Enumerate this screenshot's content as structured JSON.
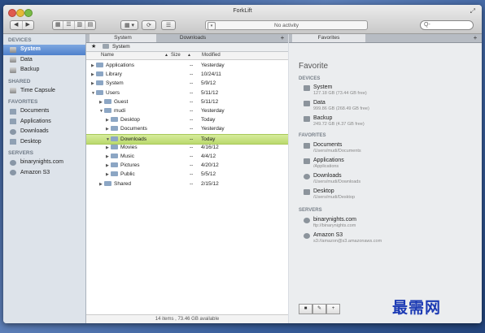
{
  "window": {
    "title": "ForkLift",
    "activity": "No activity",
    "search_placeholder": "Q-"
  },
  "toolbar": {
    "back": "◀",
    "forward": "▶",
    "view_modes": [
      "▦",
      "☰",
      "▥",
      "▤"
    ],
    "action": "▦ ▾",
    "sync": "⟳",
    "info": "☰"
  },
  "sidebar": {
    "devices_header": "DEVICES",
    "devices": [
      "System",
      "Data",
      "Backup"
    ],
    "shared_header": "SHARED",
    "shared": [
      "Time Capsule"
    ],
    "favorites_header": "FAVORITES",
    "favorites": [
      "Documents",
      "Applications",
      "Downloads",
      "Desktop"
    ],
    "servers_header": "SERVERS",
    "servers": [
      "binarynights.com",
      "Amazon S3"
    ]
  },
  "pane": {
    "tabs": [
      "System",
      "Downloads"
    ],
    "tab_add": "+",
    "path_star": "★",
    "path_label": "System",
    "columns": {
      "name": "Name",
      "size": "Size",
      "modified": "Modified"
    },
    "rows": [
      {
        "name": "Applications",
        "size": "--",
        "modified": "Yesterday",
        "arrow": "▶"
      },
      {
        "name": "Library",
        "size": "--",
        "modified": "10/24/11",
        "arrow": "▶"
      },
      {
        "name": "System",
        "size": "--",
        "modified": "5/9/12",
        "arrow": "▶"
      },
      {
        "name": "Users",
        "size": "--",
        "modified": "5/11/12",
        "arrow": "▼"
      },
      {
        "name": "Guest",
        "size": "--",
        "modified": "5/11/12",
        "arrow": "▶"
      },
      {
        "name": "mudi",
        "size": "--",
        "modified": "Yesterday",
        "arrow": "▼"
      },
      {
        "name": "Desktop",
        "size": "--",
        "modified": "Today",
        "arrow": "▶"
      },
      {
        "name": "Documents",
        "size": "--",
        "modified": "Yesterday",
        "arrow": "▶"
      },
      {
        "name": "Downloads",
        "size": "--",
        "modified": "Today",
        "arrow": "▼"
      },
      {
        "name": "Movies",
        "size": "--",
        "modified": "4/16/12",
        "arrow": "▶"
      },
      {
        "name": "Music",
        "size": "--",
        "modified": "4/4/12",
        "arrow": "▶"
      },
      {
        "name": "Pictures",
        "size": "--",
        "modified": "4/20/12",
        "arrow": "▶"
      },
      {
        "name": "Public",
        "size": "--",
        "modified": "5/5/12",
        "arrow": "▶"
      },
      {
        "name": "Shared",
        "size": "--",
        "modified": "2/15/12",
        "arrow": "▶"
      }
    ],
    "footer": "14 items , 73.46 GB available"
  },
  "favorites_panel": {
    "tab_label": "Favorites",
    "tab_add": "+",
    "title": "Favorite",
    "devices_header": "DEVICES",
    "devices": [
      {
        "name": "System",
        "sub": "127.18 GB (73.44 GB free)"
      },
      {
        "name": "Data",
        "sub": "999.86 GB (268.49 GB free)"
      },
      {
        "name": "Backup",
        "sub": "249.72 GB (4.37 GB free)"
      }
    ],
    "favorites_header": "FAVORITES",
    "favorites": [
      {
        "name": "Documents",
        "sub": "/Users/mudi/Documents"
      },
      {
        "name": "Applications",
        "sub": "/Applications"
      },
      {
        "name": "Downloads",
        "sub": "/Users/mudi/Downloads"
      },
      {
        "name": "Desktop",
        "sub": "/Users/mudi/Desktop"
      }
    ],
    "servers_header": "SERVERS",
    "servers": [
      {
        "name": "binarynights.com",
        "sub": "ftp://binarynights.com"
      },
      {
        "name": "Amazon S3",
        "sub": "s3://amazon@s3.amazonaws.com"
      }
    ],
    "buttons": [
      "■",
      "✎",
      "+"
    ]
  },
  "watermark": "最需网"
}
